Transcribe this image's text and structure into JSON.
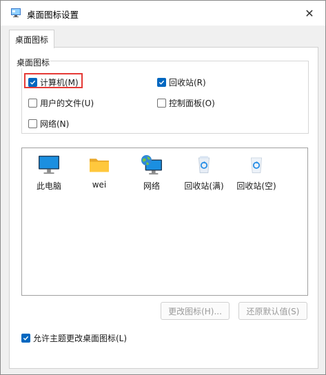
{
  "window": {
    "title": "桌面图标设置",
    "close_glyph": "✕"
  },
  "tab": {
    "label": "桌面图标"
  },
  "group": {
    "legend": "桌面图标",
    "checkboxes": [
      {
        "label": "计算机(M)",
        "checked": true
      },
      {
        "label": "回收站(R)",
        "checked": true
      },
      {
        "label": "用户的文件(U)",
        "checked": false
      },
      {
        "label": "控制面板(O)",
        "checked": false
      },
      {
        "label": "网络(N)",
        "checked": false
      }
    ]
  },
  "icons": [
    {
      "label": "此电脑",
      "icon": "monitor-icon"
    },
    {
      "label": "wei",
      "icon": "folder-icon"
    },
    {
      "label": "网络",
      "icon": "network-globe-icon"
    },
    {
      "label": "回收站(满)",
      "icon": "recycle-bin-full-icon"
    },
    {
      "label": "回收站(空)",
      "icon": "recycle-bin-empty-icon"
    }
  ],
  "buttons": {
    "change_icon": "更改图标(H)...",
    "restore_default": "还原默认值(S)"
  },
  "theme_option": {
    "label": "允许主题更改桌面图标(L)",
    "checked": true
  },
  "colors": {
    "accent": "#0067c0",
    "highlight": "#e53935"
  }
}
